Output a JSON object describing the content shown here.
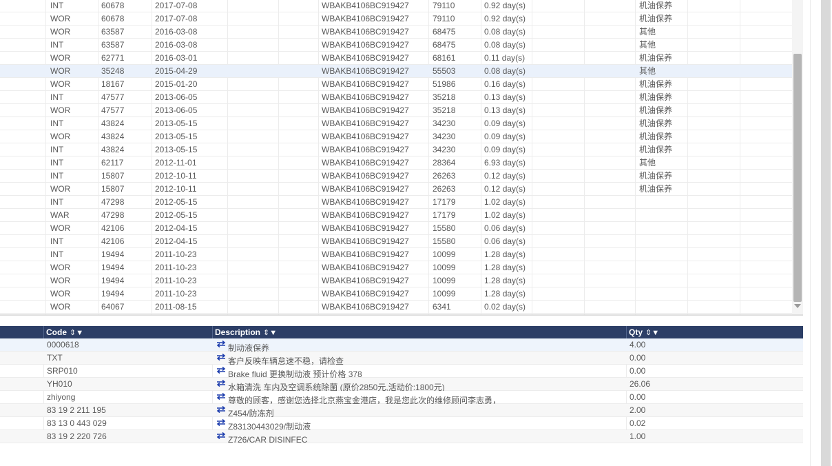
{
  "history": {
    "rows": [
      {
        "type": "INT",
        "order": "60678",
        "date": "2017-07-08",
        "vin": "WBAKB4106BC919427",
        "mileage": "79110",
        "duration": "0.92 day(s)",
        "category": "机油保养"
      },
      {
        "type": "WOR",
        "order": "60678",
        "date": "2017-07-08",
        "vin": "WBAKB4106BC919427",
        "mileage": "79110",
        "duration": "0.92 day(s)",
        "category": "机油保养"
      },
      {
        "type": "WOR",
        "order": "63587",
        "date": "2016-03-08",
        "vin": "WBAKB4106BC919427",
        "mileage": "68475",
        "duration": "0.08 day(s)",
        "category": "其他"
      },
      {
        "type": "INT",
        "order": "63587",
        "date": "2016-03-08",
        "vin": "WBAKB4106BC919427",
        "mileage": "68475",
        "duration": "0.08 day(s)",
        "category": "其他"
      },
      {
        "type": "WOR",
        "order": "62771",
        "date": "2016-03-01",
        "vin": "WBAKB4106BC919427",
        "mileage": "68161",
        "duration": "0.11 day(s)",
        "category": "机油保养"
      },
      {
        "type": "WOR",
        "order": "35248",
        "date": "2015-04-29",
        "vin": "WBAKB4106BC919427",
        "mileage": "55503",
        "duration": "0.08 day(s)",
        "category": "其他"
      },
      {
        "type": "WOR",
        "order": "18167",
        "date": "2015-01-20",
        "vin": "WBAKB4106BC919427",
        "mileage": "51986",
        "duration": "0.16 day(s)",
        "category": "机油保养"
      },
      {
        "type": "INT",
        "order": "47577",
        "date": "2013-06-05",
        "vin": "WBAKB4106BC919427",
        "mileage": "35218",
        "duration": "0.13 day(s)",
        "category": "机油保养"
      },
      {
        "type": "WOR",
        "order": "47577",
        "date": "2013-06-05",
        "vin": "WBAKB4106BC919427",
        "mileage": "35218",
        "duration": "0.13 day(s)",
        "category": "机油保养"
      },
      {
        "type": "INT",
        "order": "43824",
        "date": "2013-05-15",
        "vin": "WBAKB4106BC919427",
        "mileage": "34230",
        "duration": "0.09 day(s)",
        "category": "机油保养"
      },
      {
        "type": "WOR",
        "order": "43824",
        "date": "2013-05-15",
        "vin": "WBAKB4106BC919427",
        "mileage": "34230",
        "duration": "0.09 day(s)",
        "category": "机油保养"
      },
      {
        "type": "INT",
        "order": "43824",
        "date": "2013-05-15",
        "vin": "WBAKB4106BC919427",
        "mileage": "34230",
        "duration": "0.09 day(s)",
        "category": "机油保养"
      },
      {
        "type": "INT",
        "order": "62117",
        "date": "2012-11-01",
        "vin": "WBAKB4106BC919427",
        "mileage": "28364",
        "duration": "6.93 day(s)",
        "category": "其他"
      },
      {
        "type": "INT",
        "order": "15807",
        "date": "2012-10-11",
        "vin": "WBAKB4106BC919427",
        "mileage": "26263",
        "duration": "0.12 day(s)",
        "category": "机油保养"
      },
      {
        "type": "WOR",
        "order": "15807",
        "date": "2012-10-11",
        "vin": "WBAKB4106BC919427",
        "mileage": "26263",
        "duration": "0.12 day(s)",
        "category": "机油保养"
      },
      {
        "type": "INT",
        "order": "47298",
        "date": "2012-05-15",
        "vin": "WBAKB4106BC919427",
        "mileage": "17179",
        "duration": "1.02 day(s)",
        "category": ""
      },
      {
        "type": "WAR",
        "order": "47298",
        "date": "2012-05-15",
        "vin": "WBAKB4106BC919427",
        "mileage": "17179",
        "duration": "1.02 day(s)",
        "category": ""
      },
      {
        "type": "WOR",
        "order": "42106",
        "date": "2012-04-15",
        "vin": "WBAKB4106BC919427",
        "mileage": "15580",
        "duration": "0.06 day(s)",
        "category": ""
      },
      {
        "type": "INT",
        "order": "42106",
        "date": "2012-04-15",
        "vin": "WBAKB4106BC919427",
        "mileage": "15580",
        "duration": "0.06 day(s)",
        "category": ""
      },
      {
        "type": "INT",
        "order": "19494",
        "date": "2011-10-23",
        "vin": "WBAKB4106BC919427",
        "mileage": "10099",
        "duration": "1.28 day(s)",
        "category": ""
      },
      {
        "type": "WOR",
        "order": "19494",
        "date": "2011-10-23",
        "vin": "WBAKB4106BC919427",
        "mileage": "10099",
        "duration": "1.28 day(s)",
        "category": ""
      },
      {
        "type": "WOR",
        "order": "19494",
        "date": "2011-10-23",
        "vin": "WBAKB4106BC919427",
        "mileage": "10099",
        "duration": "1.28 day(s)",
        "category": ""
      },
      {
        "type": "WOR",
        "order": "19494",
        "date": "2011-10-23",
        "vin": "WBAKB4106BC919427",
        "mileage": "10099",
        "duration": "1.28 day(s)",
        "category": ""
      },
      {
        "type": "WOR",
        "order": "64067",
        "date": "2011-08-15",
        "vin": "WBAKB4106BC919427",
        "mileage": "6341",
        "duration": "0.02 day(s)",
        "category": ""
      }
    ]
  },
  "detail": {
    "headers": {
      "code": "Code",
      "description": "Description",
      "qty": "Qty"
    },
    "sort_filter_glyphs": "⇕▼",
    "rows": [
      {
        "code": "0000618",
        "description": "制动液保养",
        "qty": "4.00"
      },
      {
        "code": "TXT",
        "description": "客户反映车辆怠速不稳，请检查",
        "qty": "0.00"
      },
      {
        "code": "SRP010",
        "description": "Brake fluid 更换制动液 预计价格 378",
        "qty": "0.00"
      },
      {
        "code": "YH010",
        "description": "水箱清洗 车内及空调系统除菌 (原价2850元,活动价:1800元)",
        "qty": "26.06"
      },
      {
        "code": "zhiyong",
        "description": "尊敬的顾客，感谢您选择北京燕宝金港店，我是您此次的维修顾问李志勇，",
        "qty": "0.00"
      },
      {
        "code": "83 19 2 211 195",
        "description": "Z454/防冻剂",
        "qty": "2.00"
      },
      {
        "code": "83 13 0 443 029",
        "description": "Z83130443029/制动液",
        "qty": "0.02"
      },
      {
        "code": "83 19 2 220 726",
        "description": "Z726/CAR DISINFEC",
        "qty": "1.00"
      }
    ]
  },
  "colors": {
    "header_bg": "#2c3e66",
    "swap_icon": "#1f3fae",
    "selected_row": "#eaf1fb"
  }
}
